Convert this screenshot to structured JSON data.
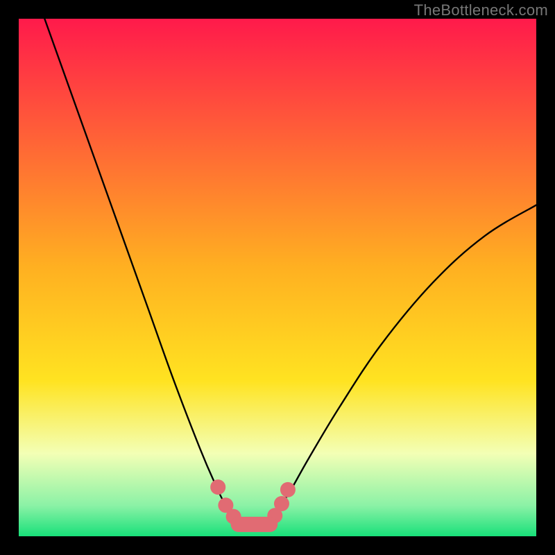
{
  "watermark": "TheBottleneck.com",
  "chart_data": {
    "type": "line",
    "title": "",
    "xlabel": "",
    "ylabel": "",
    "x_range": [
      0,
      100
    ],
    "y_range": [
      0,
      100
    ],
    "grid": false,
    "legend": false,
    "annotations": [],
    "series": [
      {
        "name": "curve-left",
        "stroke": "#000000",
        "x": [
          5,
          10,
          15,
          20,
          25,
          30,
          35,
          38,
          40,
          42
        ],
        "y": [
          100,
          86,
          72,
          58,
          44,
          30,
          17,
          10,
          6,
          4
        ]
      },
      {
        "name": "curve-right",
        "stroke": "#000000",
        "x": [
          49,
          52,
          56,
          62,
          70,
          80,
          90,
          100
        ],
        "y": [
          4,
          8,
          15,
          25,
          37,
          49,
          58,
          64
        ]
      },
      {
        "name": "marker-left-dots",
        "stroke": "#e16b73",
        "type_hint": "scatter",
        "x": [
          38.5,
          40.0,
          41.5
        ],
        "y": [
          9.5,
          6.0,
          3.8
        ]
      },
      {
        "name": "marker-right-dots",
        "stroke": "#e16b73",
        "type_hint": "scatter",
        "x": [
          49.5,
          50.8,
          52.0
        ],
        "y": [
          4.0,
          6.3,
          9.0
        ]
      },
      {
        "name": "marker-trough-bar",
        "stroke": "#e16b73",
        "type_hint": "line",
        "x": [
          41.5,
          49.5
        ],
        "y": [
          2.3,
          2.3
        ]
      }
    ],
    "background_gradient": {
      "top": "#ff1a4b",
      "mid": "#ffe321",
      "low": "#f3ffb5",
      "bottom": "#18e07a"
    }
  }
}
